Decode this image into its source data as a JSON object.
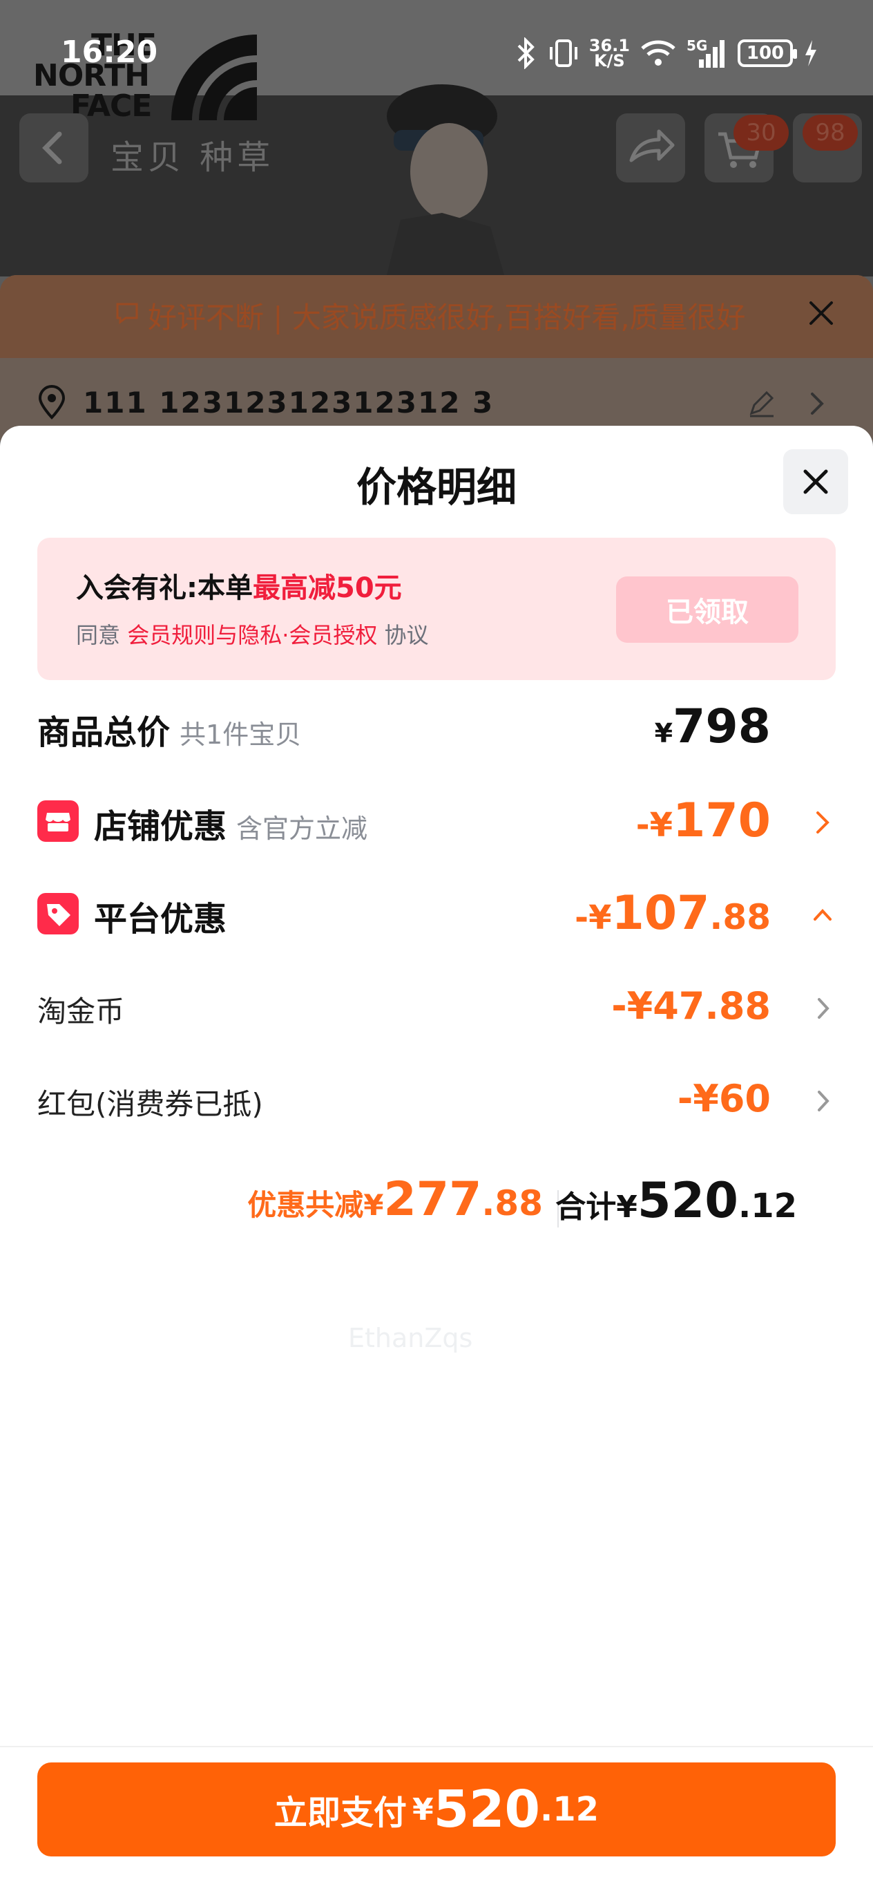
{
  "status_bar": {
    "time": "16:20",
    "net_speed_top": "36.1",
    "net_speed_unit": "K/S",
    "signal_label": "5G",
    "battery": "100"
  },
  "background": {
    "brand_line1": "THE",
    "brand_line2": "NORTH",
    "brand_line3": "FACE",
    "nav_tabs": "宝贝 种草",
    "cart_badge": "30",
    "msg_badge": "98",
    "review_text": "好评不断 | 大家说质感很好,百搭好看,质量很好",
    "address": "111 12312312312312 3"
  },
  "sheet": {
    "title": "价格明细",
    "member": {
      "title_prefix": "入会有礼:本单",
      "title_highlight": "最高减50元",
      "agree_prefix": "同意 ",
      "agree_link": "会员规则与隐私·会员授权",
      "agree_suffix": " 协议",
      "button": "已领取"
    },
    "rows": {
      "total": {
        "label": "商品总价",
        "sub": "共1件宝贝",
        "currency": "¥",
        "value": "798"
      },
      "shop": {
        "label": "店铺优惠",
        "sub": "含官方立减",
        "prefix": "-¥",
        "value": "170"
      },
      "platform": {
        "label": "平台优惠",
        "prefix": "-¥",
        "value_int": "107",
        "value_dec": ".88"
      },
      "coin": {
        "label": "淘金币",
        "prefix": "-¥",
        "value": "47.88"
      },
      "redpacket": {
        "label": "红包(消费券已抵)",
        "prefix": "-¥",
        "value": "60"
      }
    },
    "watermark": "EthanZqs",
    "totals": {
      "discount_label": "优惠共减",
      "currency": "¥",
      "discount_int": "277",
      "discount_dec": ".88",
      "sum_label": "合计",
      "sum_int": "520",
      "sum_dec": ".12"
    },
    "pay": {
      "label": "立即支付",
      "currency": "¥",
      "int": "520",
      "dec": ".12"
    }
  },
  "colors": {
    "accent": "#ff6207",
    "discount": "#ff6a1a",
    "member_bg": "#ffe5e7",
    "member_highlight": "#f01e3c",
    "claimed_btn": "#ffc5cd"
  }
}
